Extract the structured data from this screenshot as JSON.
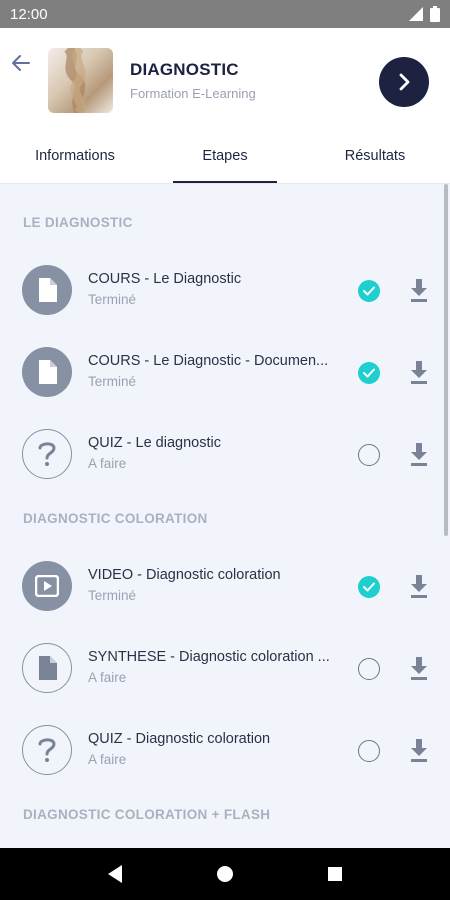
{
  "status_bar": {
    "time": "12:00"
  },
  "header": {
    "title": "DIAGNOSTIC",
    "subtitle": "Formation E-Learning",
    "back_icon": "arrow-left-icon",
    "next_icon": "chevron-right-icon"
  },
  "tabs": [
    {
      "label": "Informations",
      "active": false
    },
    {
      "label": "Etapes",
      "active": true
    },
    {
      "label": "Résultats",
      "active": false
    }
  ],
  "sections": [
    {
      "title": "LE DIAGNOSTIC",
      "items": [
        {
          "title": "COURS - Le Diagnostic",
          "status": "Terminé",
          "icon": "document-icon",
          "done": true
        },
        {
          "title": "COURS - Le Diagnostic - Documen...",
          "status": "Terminé",
          "icon": "document-icon",
          "done": true
        },
        {
          "title": "QUIZ - Le diagnostic",
          "status": "A faire",
          "icon": "question-icon",
          "done": false
        }
      ]
    },
    {
      "title": "DIAGNOSTIC COLORATION",
      "items": [
        {
          "title": "VIDEO - Diagnostic coloration",
          "status": "Terminé",
          "icon": "video-icon",
          "done": true
        },
        {
          "title": "SYNTHESE - Diagnostic coloration ...",
          "status": "A faire",
          "icon": "document-icon",
          "done": false
        },
        {
          "title": "QUIZ - Diagnostic coloration",
          "status": "A faire",
          "icon": "question-icon",
          "done": false
        }
      ]
    },
    {
      "title": "DIAGNOSTIC COLORATION + FLASH",
      "items": []
    }
  ],
  "colors": {
    "accent": "#1c2240",
    "done_check": "#1fcfcf",
    "icon_gray": "#8791a4",
    "content_bg": "#f1f5fb"
  }
}
